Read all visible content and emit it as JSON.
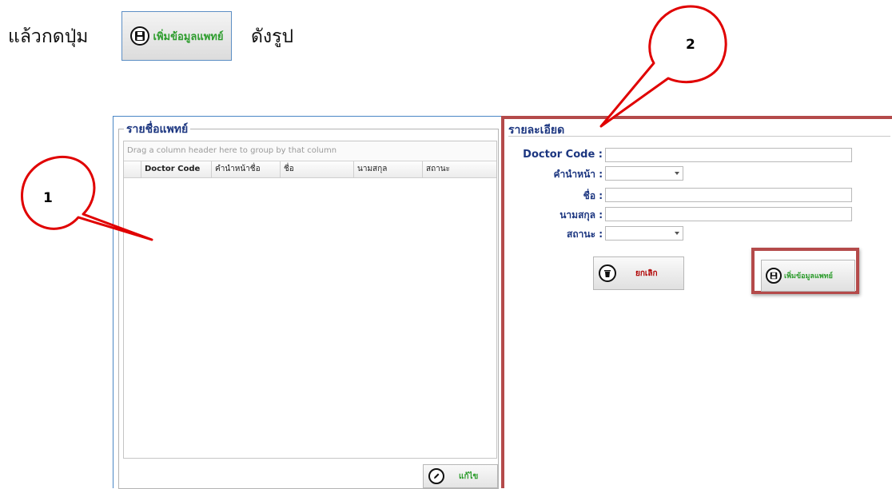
{
  "instruction": {
    "prefix": "แล้วกดปุ่ม",
    "suffix": "ดังรูป"
  },
  "sample_button": {
    "label": "เพิ่มข้อมูลแพทย์",
    "icon": "save-disk-icon"
  },
  "callouts": {
    "left_number": "1",
    "right_number": "2"
  },
  "doctor_list": {
    "title": "รายชื่อแพทย์",
    "group_hint": "Drag a column header here to group by that column",
    "columns": [
      "Doctor Code",
      "คำนำหน้าชื่อ",
      "ชื่อ",
      "นามสกุล",
      "สถานะ"
    ],
    "edit_button": {
      "label": "แก้ไข",
      "icon": "pencil-circle-icon"
    }
  },
  "detail": {
    "title": "รายละเอียด",
    "fields": {
      "doctor_code": {
        "label": "Doctor Code :",
        "value": ""
      },
      "prefix": {
        "label": "คำนำหน้า :",
        "value": ""
      },
      "first_name": {
        "label": "ชื่อ :",
        "value": ""
      },
      "last_name": {
        "label": "นามสกุล :",
        "value": ""
      },
      "status": {
        "label": "สถานะ :",
        "value": ""
      }
    },
    "cancel_button": {
      "label": "ยกเลิก",
      "icon": "trash-circle-icon"
    },
    "save_button": {
      "label": "เพิ่มข้อมูลแพทย์",
      "icon": "save-disk-icon"
    }
  },
  "colors": {
    "accent_red": "#b44a4a",
    "callout_red": "#e00000",
    "title_navy": "#1c3680",
    "label_green": "#2e9d2e",
    "window_blue": "#4a86c5"
  }
}
